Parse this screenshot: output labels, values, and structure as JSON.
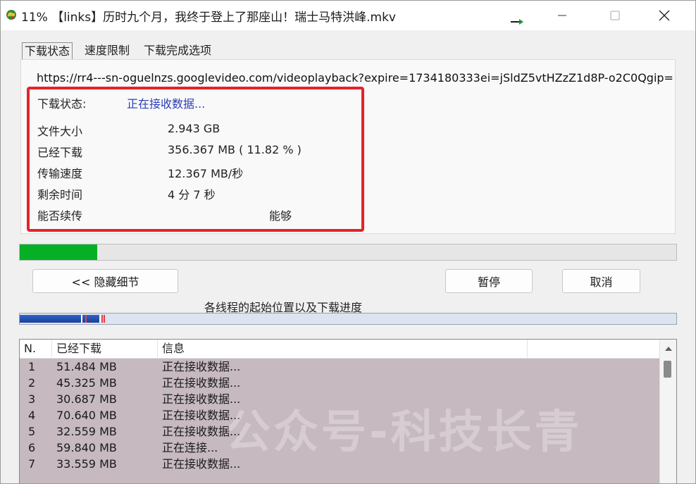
{
  "window": {
    "title": "11%  【links】历时九个月，我终于登上了那座山！瑞士马特洪峰.mkv"
  },
  "tabs": [
    {
      "label": "下载状态",
      "active": true
    },
    {
      "label": "速度限制",
      "active": false
    },
    {
      "label": "下载完成选项",
      "active": false
    }
  ],
  "url": "https://rr4---sn-oguelnzs.googlevideo.com/videoplayback?expire=1734180333ei=jSldZ5vtHZzZ1d8P-o2C0Qgip=",
  "status": {
    "label": "下载状态:",
    "value": "正在接收数据..."
  },
  "info": [
    {
      "label": "文件大小",
      "value": "2.943  GB"
    },
    {
      "label": "已经下载",
      "value": "356.367  MB  ( 11.82 % )"
    },
    {
      "label": "传输速度",
      "value": "12.367  MB/秒"
    },
    {
      "label": "剩余时间",
      "value": "4 分 7 秒"
    },
    {
      "label": "能否续传",
      "value": "能够"
    }
  ],
  "progress": {
    "percent": 11.82,
    "color": "#06b025"
  },
  "buttons": {
    "hide_details": "<< 隐藏细节",
    "pause": "暂停",
    "cancel": "取消"
  },
  "thread_caption": "各线程的起始位置以及下载进度",
  "list": {
    "headers": [
      "N.",
      "已经下载",
      "信息"
    ],
    "rows": [
      {
        "n": "1",
        "downloaded": "51.484  MB",
        "info": "正在接收数据..."
      },
      {
        "n": "2",
        "downloaded": "45.325  MB",
        "info": "正在接收数据..."
      },
      {
        "n": "3",
        "downloaded": "30.687  MB",
        "info": "正在接收数据..."
      },
      {
        "n": "4",
        "downloaded": "70.640  MB",
        "info": "正在接收数据..."
      },
      {
        "n": "5",
        "downloaded": "32.559  MB",
        "info": "正在接收数据..."
      },
      {
        "n": "6",
        "downloaded": "59.840  MB",
        "info": "正在连接..."
      },
      {
        "n": "7",
        "downloaded": "33.559  MB",
        "info": "正在接收数据..."
      }
    ]
  },
  "watermark": "公众号-科技长青",
  "icons": {
    "app": "globe-download-icon",
    "taskbar_arrow": "arrow-right-icon",
    "minimize": "minimize-icon",
    "maximize": "maximize-icon",
    "close": "close-icon",
    "scroll_up": "scroll-up-arrow-icon"
  }
}
